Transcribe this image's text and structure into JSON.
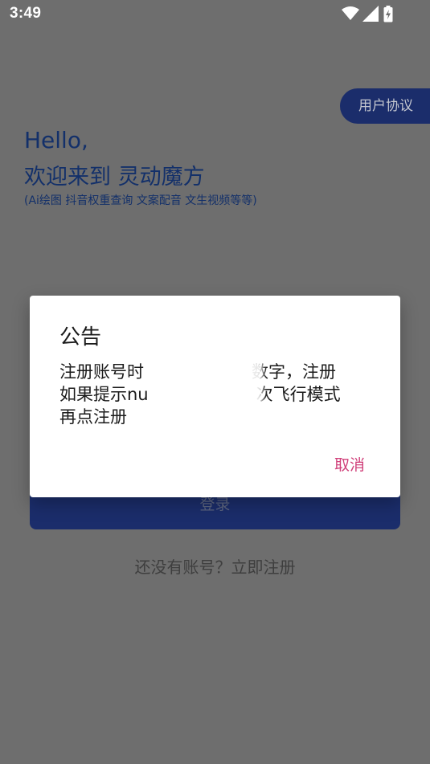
{
  "status_bar": {
    "time": "3:49",
    "icons": [
      "wifi-icon",
      "cellular-signal-icon",
      "battery-charging-icon"
    ]
  },
  "header": {
    "agreement_label": "用户协议",
    "greeting": "Hello,",
    "welcome": "欢迎来到 灵动魔方",
    "subtitle": "(Ai绘图  抖音权重查询  文案配音  文生视频等等)"
  },
  "login": {
    "button_label": "登录",
    "register_link": "还没有账号？立即注册"
  },
  "dialog": {
    "title": "公告",
    "body_line1": "注册账号时",
    "body_line1_end": "数字，注册",
    "body_line2": "如果提示nu",
    "body_line2_end": "次飞行模式",
    "body_line3": "再点注册",
    "cancel_label": "取消"
  },
  "colors": {
    "backdrop": "#6e6e6e",
    "primary": "#1b2d6b",
    "accent_cancel": "#d0407a",
    "heading": "#13306a"
  }
}
